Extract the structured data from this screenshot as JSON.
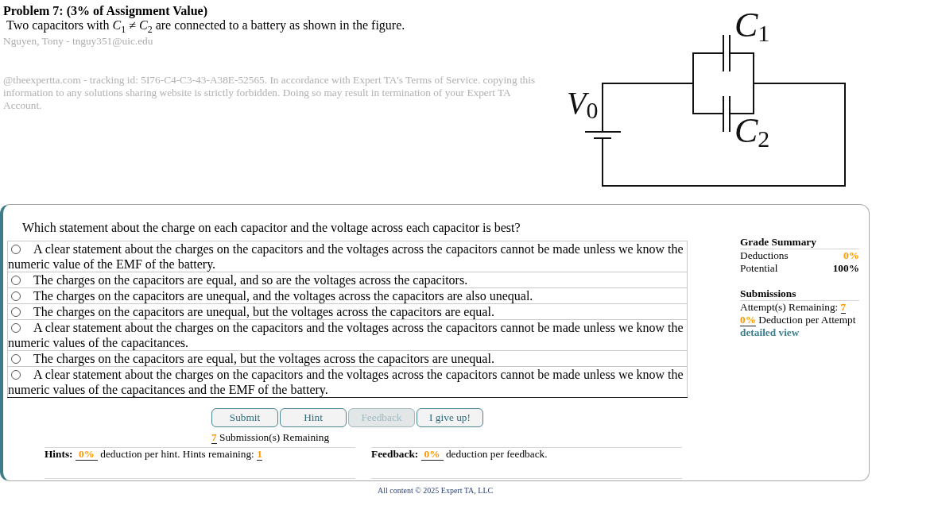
{
  "problem": {
    "title": "Problem 7: (3% of Assignment Value)",
    "statement": "Two capacitors with *C*$_{1}$ ≠ *C*$_{2}$ are connected to a battery as shown in the figure.",
    "student": "Nguyen, Tony - tnguy351@uic.edu",
    "notice": "@theexpertta.com - tracking id: 5I76-C4-C3-43-A38E-52565. In accordance with Expert TA's Terms of Service. copying this information to any solutions sharing website is strictly forbidden. Doing so may result in termination of your Expert TA Account."
  },
  "figure": {
    "battery_label": "*V*$_{0}$",
    "capacitor_labels": [
      "*C*$_{1}$",
      "*C*$_{2}$"
    ]
  },
  "question": {
    "prompt": "Which statement about the charge on each capacitor and the voltage across each capacitor is best?",
    "options": [
      {
        "text": "A clear statement about the charges on the capacitors and the voltages across the capacitors cannot be made unless we know the numeric value of the EMF of the battery.",
        "selected": false
      },
      {
        "text": "The charges on the capacitors are equal, and so are the voltages across the capacitors.",
        "selected": false
      },
      {
        "text": "The charges on the capacitors are unequal, and the voltages across the capacitors are also unequal.",
        "selected": false
      },
      {
        "text": "The charges on the capacitors are unequal, but the voltages across the capacitors are equal.",
        "selected": false
      },
      {
        "text": "A clear statement about the charges on the capacitors and the voltages across the capacitors cannot be made unless we know the numeric values of the capacitances.",
        "selected": false
      },
      {
        "text": "The charges on the capacitors are equal, but the voltages across the capacitors are unequal.",
        "selected": false
      },
      {
        "text": "A clear statement about the charges on the capacitors and the voltages across the capacitors cannot be made unless we know the numeric values of the capacitances and the EMF of the battery.",
        "selected": false
      }
    ]
  },
  "grade_summary": {
    "title": "Grade Summary",
    "rows": [
      {
        "label": "Deductions",
        "value": "0%",
        "kind": "deduction"
      },
      {
        "label": "Potential",
        "value": "100%",
        "kind": "potential"
      }
    ]
  },
  "submissions": {
    "title": "Submissions",
    "attempts_label": "Attempt(s) Remaining:",
    "attempts_value": "7",
    "deduction_value": "0%",
    "deduction_label": "Deduction per Attempt",
    "link": "detailed view"
  },
  "buttons": [
    {
      "label": "Submit",
      "disabled": false
    },
    {
      "label": "Hint",
      "disabled": false
    },
    {
      "label": "Feedback",
      "disabled": true
    },
    {
      "label": "I give up!",
      "disabled": false
    }
  ],
  "remaining": {
    "count": "7",
    "label": "Submission(s) Remaining"
  },
  "hints": {
    "title": "Hints:",
    "deduction": "0%",
    "text": "deduction per hint. Hints remaining:",
    "remaining": "1"
  },
  "feedback": {
    "title": "Feedback:",
    "deduction": "0%",
    "text": "deduction per feedback."
  },
  "footer": "All content © 2025 Expert TA, LLC"
}
